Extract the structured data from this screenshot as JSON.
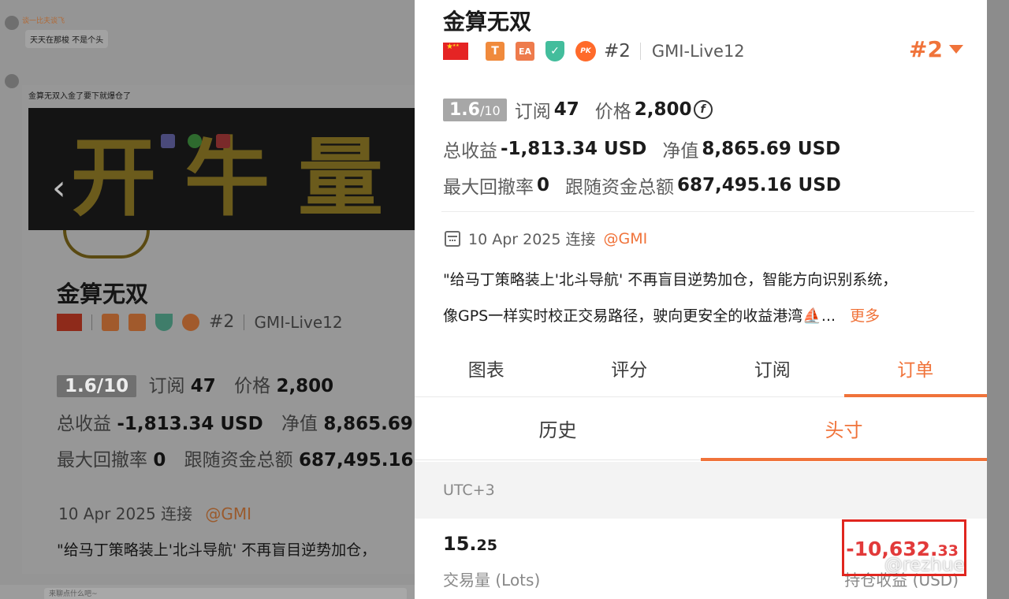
{
  "chat": {
    "msg1_name": "谈一比夫谈飞",
    "msg1_text": "天天在那梭 不是个头",
    "msg2_text": "金算无双入金了要下就爆仓了",
    "composer_placeholder": "来聊点什么吧~"
  },
  "background_screenshot": {
    "banner_text": "开牛量",
    "title": "金算无双",
    "rank": "#2",
    "server": "GMI-Live12",
    "score": "1.6",
    "score_of": "/10",
    "subscribe_label": "订阅",
    "subscribe_value": "47",
    "price_label": "价格",
    "price_value": "2,800",
    "total_label": "总收益",
    "total_value": "-1,813.34 USD",
    "equity_label": "净值",
    "equity_value": "8,865.69 US",
    "drawdown_label": "最大回撤率",
    "drawdown_value": "0",
    "follow_label": "跟随资金总额",
    "follow_value": "687,495.16",
    "date": "10 Apr 2025 连接",
    "at": "@GMI",
    "quote": "\"给马丁策略装上'北斗导航' 不再盲目逆势加仓，"
  },
  "card": {
    "title": "金算无双",
    "badges": {
      "t": "T",
      "ea": "EA",
      "shield": "✓",
      "pk": "PK"
    },
    "rank": "#2",
    "server": "GMI-Live12",
    "rank_selector": "#2",
    "score": "1.6",
    "score_of": "/10",
    "subscribe_label": "订阅",
    "subscribe_value": "47",
    "price_label": "价格",
    "price_value": "2,800",
    "coin_symbol": "f",
    "total_label": "总收益",
    "total_value": "-1,813.34 USD",
    "equity_label": "净值",
    "equity_value": "8,865.69 USD",
    "drawdown_label": "最大回撤率",
    "drawdown_value": "0",
    "follow_label": "跟随资金总额",
    "follow_value": "687,495.16 USD",
    "date": "10 Apr 2025 连接",
    "at": "@GMI",
    "desc_line1": "\"给马丁策略装上'北斗导航' 不再盲目逆势加仓，智能方向识别系统，",
    "desc_line2": "像GPS一样实时校正交易路径，驶向更安全的收益港湾⛵...",
    "more": "更多",
    "tabs": [
      {
        "label": "图表"
      },
      {
        "label": "评分"
      },
      {
        "label": "订阅"
      },
      {
        "label": "订单"
      }
    ],
    "subtabs": [
      {
        "label": "历史"
      },
      {
        "label": "头寸"
      }
    ],
    "timezone": "UTC+3",
    "lots_int": "15.",
    "lots_dec": "25",
    "lots_label": "交易量 (Lots)",
    "pnl_int": "-10,632.",
    "pnl_dec": "33",
    "pnl_label": "持仓收益 (USD)"
  },
  "watermark": "@rezhue",
  "colors": {
    "accent": "#f0733a",
    "loss": "#e23a3a",
    "highlight_box": "#e0261f"
  }
}
